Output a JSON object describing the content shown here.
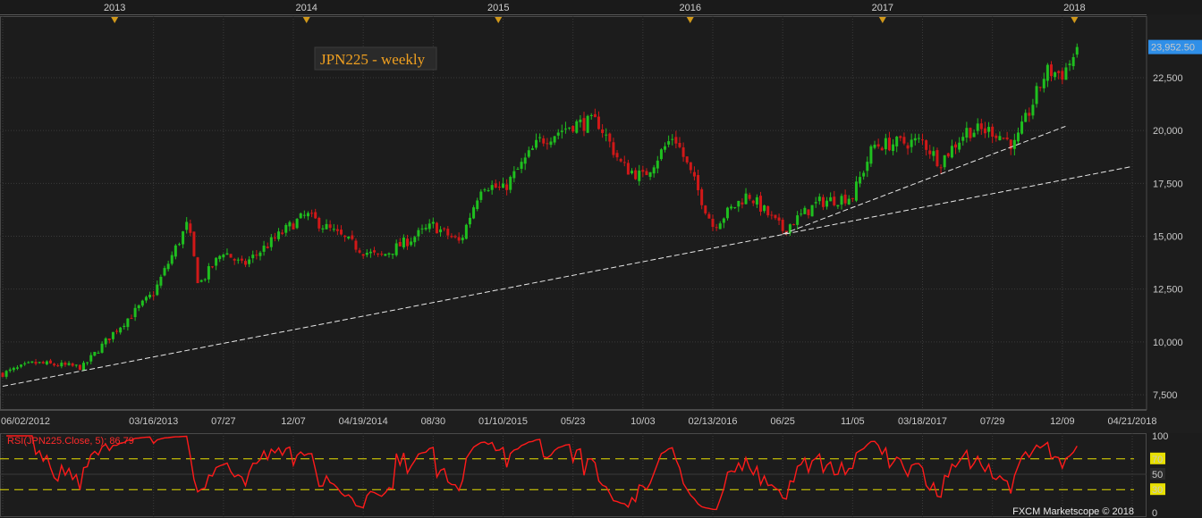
{
  "chart_data": [
    {
      "type": "candlestick",
      "title": "JPN225 - weekly",
      "ylim": [
        7500,
        24500
      ],
      "y_ticks": [
        "7,500",
        "10,000",
        "12,500",
        "15,000",
        "17,500",
        "20,000",
        "22,500"
      ],
      "y_tick_values": [
        7500,
        10000,
        12500,
        15000,
        17500,
        20000,
        22500
      ],
      "x_date_labels": [
        "06/02/2012",
        "03/16/2013",
        "07/27",
        "12/07",
        "04/19/2014",
        "08/30",
        "01/10/2015",
        "05/23",
        "10/03",
        "02/13/2016",
        "06/25",
        "11/05",
        "03/18/2017",
        "07/29",
        "12/09",
        "04/21/2018"
      ],
      "year_markers": [
        "2013",
        "2014",
        "2015",
        "2016",
        "2017",
        "2018"
      ],
      "last_price": "23,952.50",
      "colors": {
        "up": "#1fbf1f",
        "down": "#d01818",
        "background": "#1c1c1c",
        "grid": "#3a3a3a",
        "trendline": "#e8e8e8",
        "last_price_box": "#2f8fe8"
      },
      "weekly_close_keypoints": [
        {
          "date": "2012-06-02",
          "close": 8500
        },
        {
          "date": "2012-08-01",
          "close": 9000
        },
        {
          "date": "2012-11-01",
          "close": 8800
        },
        {
          "date": "2013-01-01",
          "close": 10500
        },
        {
          "date": "2013-03-16",
          "close": 12300
        },
        {
          "date": "2013-05-20",
          "close": 15600
        },
        {
          "date": "2013-06-10",
          "close": 12700
        },
        {
          "date": "2013-07-27",
          "close": 14300
        },
        {
          "date": "2013-09-01",
          "close": 13600
        },
        {
          "date": "2013-12-07",
          "close": 15600
        },
        {
          "date": "2014-01-01",
          "close": 16000
        },
        {
          "date": "2014-04-19",
          "close": 14300
        },
        {
          "date": "2014-05-20",
          "close": 14000
        },
        {
          "date": "2014-08-30",
          "close": 15500
        },
        {
          "date": "2014-10-20",
          "close": 14700
        },
        {
          "date": "2014-12-01",
          "close": 17500
        },
        {
          "date": "2015-01-10",
          "close": 17200
        },
        {
          "date": "2015-03-20",
          "close": 19500
        },
        {
          "date": "2015-05-23",
          "close": 20300
        },
        {
          "date": "2015-07-10",
          "close": 20400
        },
        {
          "date": "2015-08-25",
          "close": 18300
        },
        {
          "date": "2015-10-03",
          "close": 17800
        },
        {
          "date": "2015-12-01",
          "close": 19800
        },
        {
          "date": "2016-01-10",
          "close": 17500
        },
        {
          "date": "2016-02-13",
          "close": 15500
        },
        {
          "date": "2016-04-20",
          "close": 17000
        },
        {
          "date": "2016-06-25",
          "close": 15300
        },
        {
          "date": "2016-09-01",
          "close": 16600
        },
        {
          "date": "2016-11-05",
          "close": 16900
        },
        {
          "date": "2016-12-15",
          "close": 19300
        },
        {
          "date": "2017-03-18",
          "close": 19500
        },
        {
          "date": "2017-04-20",
          "close": 18500
        },
        {
          "date": "2017-06-10",
          "close": 20000
        },
        {
          "date": "2017-07-29",
          "close": 20000
        },
        {
          "date": "2017-09-10",
          "close": 19300
        },
        {
          "date": "2017-11-08",
          "close": 22800
        },
        {
          "date": "2017-12-09",
          "close": 22700
        },
        {
          "date": "2018-01-12",
          "close": 23952.5
        }
      ],
      "trendlines": [
        {
          "from": {
            "date": "2012-06-02",
            "value": 7900
          },
          "to": {
            "date": "2018-04-21",
            "value": 18300
          }
        },
        {
          "from": {
            "date": "2016-06-25",
            "value": 15100
          },
          "to": {
            "date": "2017-12-15",
            "value": 20200
          }
        }
      ],
      "grid": true
    },
    {
      "type": "line",
      "label": "RSI(JPN225.Close, 5): 86.79",
      "ylim": [
        0,
        100
      ],
      "y_ticks": [
        "100",
        "70",
        "50",
        "30",
        "0"
      ],
      "y_tick_values": [
        100,
        70,
        50,
        30,
        0
      ],
      "reference_lines": [
        70,
        30
      ],
      "line_color": "#ff1a1a",
      "last_value": 86.79
    }
  ],
  "footer": {
    "credit": "FXCM Marketscope © 2018"
  }
}
